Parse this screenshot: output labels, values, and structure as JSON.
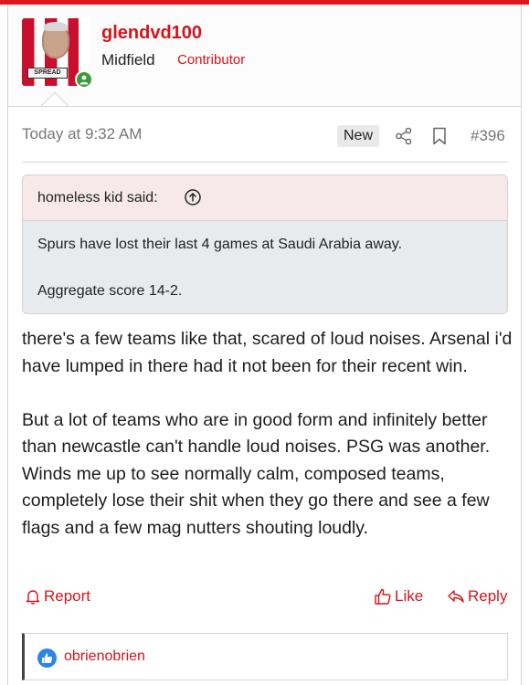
{
  "user": {
    "name": "glendvd100",
    "title": "Midfield",
    "badge": "Contributor",
    "avatar_sponsor": "SPREAD",
    "accent": "#d4151c"
  },
  "meta": {
    "timestamp": "Today at 9:32 AM",
    "new_label": "New",
    "post_number": "#396"
  },
  "quote": {
    "author": "homeless kid said:",
    "lines": [
      "Spurs have lost their last 4 games at Saudi Arabia away.",
      "Aggregate score 14-2."
    ]
  },
  "body": {
    "paragraphs": [
      "there's a few teams like that, scared of loud noises. Arsenal i'd have lumped in there had it not been for their recent win.",
      "But a lot of teams who are in good form and infinitely better than newcastle can't handle loud noises. PSG was another. Winds me up to see normally calm, composed teams, completely lose their shit when they go there and see a few flags and a few mag nutters shouting loudly."
    ]
  },
  "actions": {
    "report": "Report",
    "like": "Like",
    "reply": "Reply"
  },
  "reactions": {
    "user": "obrienobrien",
    "icon": "thumbs-up-icon"
  }
}
